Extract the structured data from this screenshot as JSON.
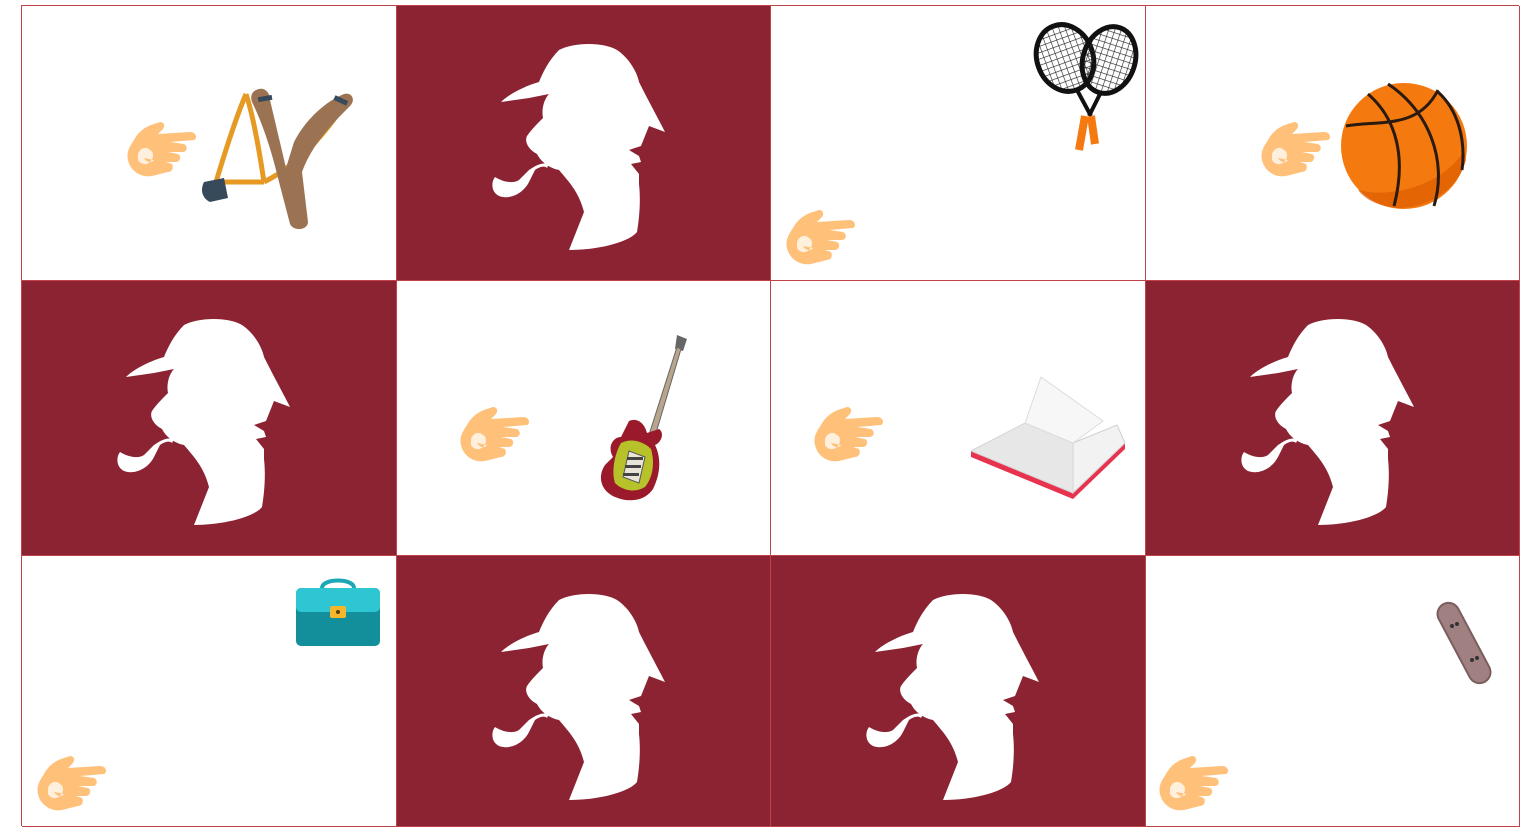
{
  "game": {
    "type": "memory-match",
    "card_back_color": "#8b2332",
    "card_face_color": "#ffffff",
    "border_color": "#c0434a",
    "pointer_icon": "pointing-hand-icon",
    "card_back_icon": "detective-silhouette-icon"
  },
  "cards": [
    {
      "state": "revealed",
      "item": "slingshot-icon"
    },
    {
      "state": "hidden",
      "item": "detective-silhouette-icon"
    },
    {
      "state": "revealed",
      "item": "tennis-rackets-icon"
    },
    {
      "state": "revealed",
      "item": "basketball-icon"
    },
    {
      "state": "hidden",
      "item": "detective-silhouette-icon"
    },
    {
      "state": "revealed",
      "item": "electric-guitar-icon"
    },
    {
      "state": "revealed",
      "item": "open-book-icon"
    },
    {
      "state": "hidden",
      "item": "detective-silhouette-icon"
    },
    {
      "state": "revealed",
      "item": "briefcase-icon"
    },
    {
      "state": "hidden",
      "item": "detective-silhouette-icon"
    },
    {
      "state": "hidden",
      "item": "detective-silhouette-icon"
    },
    {
      "state": "revealed",
      "item": "skateboard-icon"
    }
  ]
}
